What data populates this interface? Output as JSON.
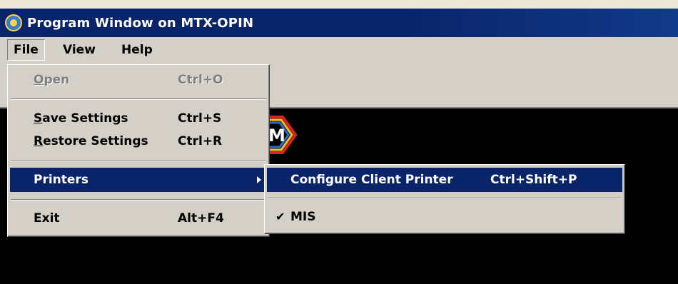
{
  "window": {
    "title": "Program Window on MTX-OPIN"
  },
  "menubar": {
    "items": [
      {
        "label": "File"
      },
      {
        "label": "View"
      },
      {
        "label": "Help"
      }
    ]
  },
  "file_menu": {
    "open": {
      "label": "Open",
      "shortcut": "Ctrl+O",
      "enabled": false
    },
    "save_settings": {
      "label": "Save Settings",
      "shortcut": "Ctrl+S"
    },
    "restore_settings": {
      "label": "Restore Settings",
      "shortcut": "Ctrl+R"
    },
    "printers": {
      "label": "Printers"
    },
    "exit": {
      "label": "Exit",
      "shortcut": "Alt+F4"
    }
  },
  "printers_menu": {
    "configure": {
      "label": "Configure Client Printer",
      "shortcut": "Ctrl+Shift+P"
    },
    "mis": {
      "label": "MIS",
      "checked": true
    }
  },
  "logo": {
    "letter": "M"
  },
  "colors": {
    "highlight": "#0a246a",
    "menu_bg": "#d4d0c8",
    "client_bg": "#000000"
  }
}
